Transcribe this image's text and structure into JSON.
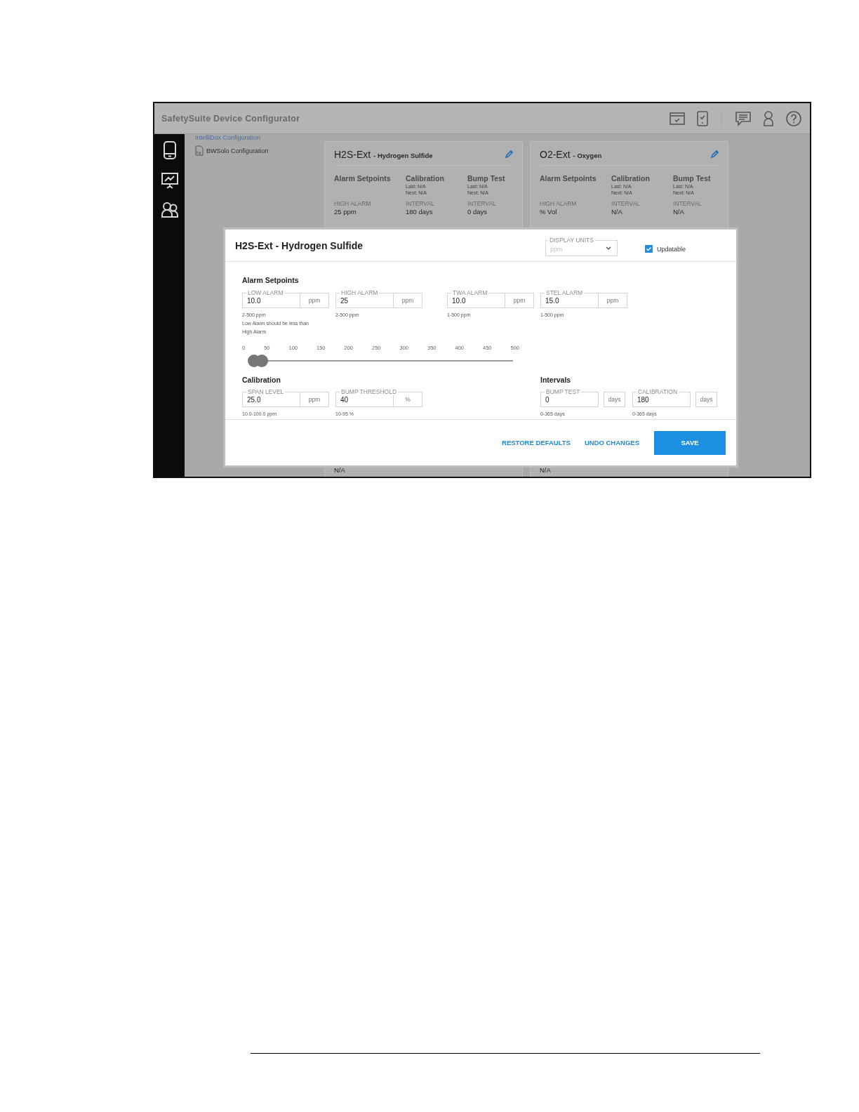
{
  "app": {
    "title": "SafetySuite Device Configurator"
  },
  "tree": [
    {
      "label": "IntelliDox Configuration",
      "kind": "link"
    },
    {
      "label": "BWSolo Configuration",
      "kind": "file"
    }
  ],
  "sensor_cards": [
    {
      "code": "H2S-Ext",
      "gas": "- Hydrogen Sulfide",
      "sections": [
        {
          "title": "Alarm Setpoints",
          "label": "HIGH ALARM",
          "value": "25 ppm"
        },
        {
          "title": "Calibration",
          "last": "Last: N/A",
          "next": "Next: N/A",
          "label": "INTERVAL",
          "value": "180 days"
        },
        {
          "title": "Bump Test",
          "last": "Last: N/A",
          "next": "Next: N/A",
          "label": "INTERVAL",
          "value": "0 days"
        }
      ],
      "bottom_value": "N/A"
    },
    {
      "code": "O2-Ext",
      "gas": "- Oxygen",
      "sections": [
        {
          "title": "Alarm Setpoints",
          "label": "HIGH ALARM",
          "value": "% Vol"
        },
        {
          "title": "Calibration",
          "last": "Last: N/A",
          "next": "Next: N/A",
          "label": "INTERVAL",
          "value": "N/A"
        },
        {
          "title": "Bump Test",
          "last": "Last: N/A",
          "next": "Next: N/A",
          "label": "INTERVAL",
          "value": "N/A"
        }
      ],
      "bottom_value": "N/A"
    }
  ],
  "dialog": {
    "title": "H2S-Ext - Hydrogen Sulfide",
    "display_units": {
      "label": "DISPLAY UNITS",
      "value": "ppm",
      "disabled": true
    },
    "updatable": {
      "label": "Updatable",
      "checked": true
    },
    "alarm_setpoints": {
      "title": "Alarm Setpoints",
      "fields": [
        {
          "label": "LOW ALARM",
          "value": "10.0",
          "unit": "ppm",
          "kind": "attached",
          "hints": [
            "2-500 ppm",
            "Low Alarm should be less than High Alarm"
          ]
        },
        {
          "label": "HIGH ALARM",
          "value": "25",
          "unit": "ppm",
          "kind": "attached",
          "hints": [
            "2-500 ppm"
          ]
        },
        {
          "label": "TWA ALARM",
          "value": "10.0",
          "unit": "ppm",
          "kind": "attached",
          "hints": [
            "1-500 ppm"
          ]
        },
        {
          "label": "STEL ALARM",
          "value": "15.0",
          "unit": "ppm",
          "kind": "attached",
          "hints": [
            "1-500 ppm"
          ]
        }
      ],
      "slider": {
        "ticks": [
          "0",
          "50",
          "100",
          "150",
          "200",
          "250",
          "300",
          "350",
          "400",
          "450",
          "500"
        ],
        "thumbs": [
          {
            "level": 0.02
          },
          {
            "level": 0.05
          }
        ]
      }
    },
    "calibration": {
      "title": "Calibration",
      "fields": [
        {
          "label": "SPAN LEVEL",
          "value": "25.0",
          "unit": "ppm",
          "kind": "attached",
          "hints": [
            "10.0-100.0 ppm"
          ]
        },
        {
          "label": "BUMP THRESHOLD",
          "value": "40",
          "unit": "%",
          "kind": "attached",
          "hints": [
            "10-95 %"
          ]
        }
      ]
    },
    "intervals": {
      "title": "Intervals",
      "fields": [
        {
          "label": "BUMP TEST",
          "value": "0",
          "unit": "days",
          "kind": "detached",
          "hints": [
            "0-365 days"
          ]
        },
        {
          "label": "CALIBRATION",
          "value": "180",
          "unit": "days",
          "kind": "detached",
          "hints": [
            "0-365 days"
          ]
        }
      ]
    },
    "buttons": [
      {
        "label": "RESTORE DEFAULTS",
        "kind": "text"
      },
      {
        "label": "UNDO CHANGES",
        "kind": "text"
      },
      {
        "label": "SAVE",
        "kind": "primary"
      }
    ]
  }
}
